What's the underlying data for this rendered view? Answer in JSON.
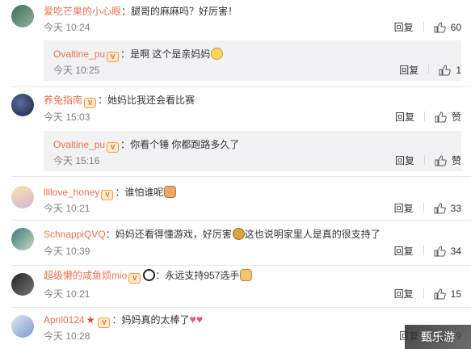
{
  "ui": {
    "reply_label": "回复",
    "like_fallback": "赞"
  },
  "comments": [
    {
      "user": "爱吃芒果的小心眼",
      "text": "腿哥的麻麻吗？好厉害！",
      "time": "今天 10:24",
      "likes": "60",
      "reply": {
        "user": "Ovaltine_pu",
        "text": "是啊 这个是亲妈妈",
        "time": "今天 10:25",
        "likes": "1"
      }
    },
    {
      "user": "养兔指南",
      "text": "她妈比我还会看比赛",
      "time": "今天 15:03",
      "likes": "赞",
      "reply": {
        "user": "Ovaltine_pu",
        "text": "你看个锤 你都跑路多久了",
        "time": "今天 15:16",
        "likes": "赞"
      }
    },
    {
      "user": "llllove_honey",
      "text": "谁怕谁呢",
      "time": "今天 10:21",
      "likes": "33"
    },
    {
      "user": "SchnappiQVQ",
      "text": "妈妈还看得懂游戏，好厉害",
      "text2": "这也说明家里人是真的很支持了",
      "time": "今天 10:39",
      "likes": "34"
    },
    {
      "user": "超级懒的咸鱼烦mio",
      "text": "永远支持957选手",
      "time": "今天 10:21",
      "likes": "15"
    },
    {
      "user": "April0124",
      "text": "妈妈真的太棒了",
      "time": "今天 10:28",
      "likes": "9"
    }
  ],
  "watermark": "甄乐游",
  "colors": {
    "username": "#eb7350",
    "timestamp": "#808080",
    "reply_bg": "#f2f2f5"
  }
}
